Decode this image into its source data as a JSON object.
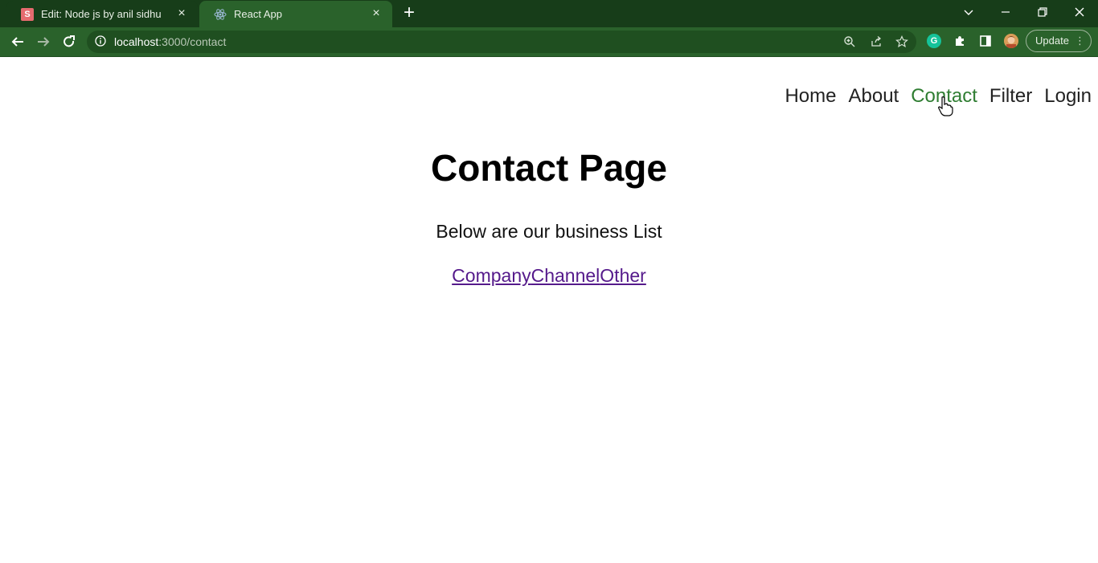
{
  "browser": {
    "tabs": [
      {
        "title": "Edit: Node js by anil sidhu",
        "favicon_letter": "S",
        "favicon": "codesandbox-s-icon",
        "active": false
      },
      {
        "title": "React App",
        "favicon": "react-logo-icon",
        "active": true
      }
    ],
    "address_bar": {
      "host": "localhost",
      "path": ":3000/contact"
    },
    "update_label": "Update",
    "update_menu": "⋮",
    "icons": {
      "back": "back-arrow-icon",
      "forward": "forward-arrow-icon",
      "reload": "reload-icon",
      "site_info": "info-icon",
      "zoom": "zoom-icon",
      "share": "share-icon",
      "bookmark": "star-icon",
      "grammarly": "grammarly-icon",
      "extensions": "puzzle-icon",
      "side_panel": "side-panel-icon",
      "profile": "avatar",
      "grammarly_letter": "G"
    },
    "colors": {
      "tab_strip": "#173d19",
      "toolbar": "#2a622b",
      "omnibox": "#1f4f20"
    }
  },
  "site_nav": {
    "items": [
      {
        "label": "Home",
        "active": false
      },
      {
        "label": "About",
        "active": false
      },
      {
        "label": "Contact",
        "active": true
      },
      {
        "label": "Filter",
        "active": false
      },
      {
        "label": "Login",
        "active": false
      }
    ],
    "active_color": "#2f7d32"
  },
  "main": {
    "title": "Contact Page",
    "subtitle": "Below are our business List",
    "links": [
      {
        "label": "Company"
      },
      {
        "label": "Channel"
      },
      {
        "label": "Other"
      }
    ]
  }
}
